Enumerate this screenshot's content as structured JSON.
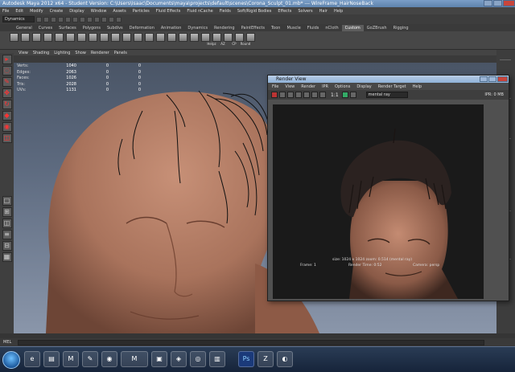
{
  "window": {
    "title": "Autodesk Maya 2012 x64 - Student Version: C:\\Users\\Isaac\\Documents\\maya\\projects\\default\\scenes\\Corona_Sculpt_01.mb* --- WireFrame_HairNoseBack"
  },
  "menubar": [
    "File",
    "Edit",
    "Modify",
    "Create",
    "Display",
    "Window",
    "Assets",
    "Particles",
    "Fluid Effects",
    "Fluid nCache",
    "Fields",
    "Soft/Rigid Bodies",
    "Effects",
    "Solvers",
    "Hair",
    "Help"
  ],
  "statusline": {
    "mode": "Dynamics"
  },
  "shelf_tabs": [
    "General",
    "Curves",
    "Surfaces",
    "Polygons",
    "Subdivs",
    "Deformation",
    "Animation",
    "Dynamics",
    "Rendering",
    "PaintEffects",
    "Toon",
    "Muscle",
    "Fluids",
    "nCloth",
    "Custom",
    "GoZBrush",
    "Rigging"
  ],
  "shelf_active": "Custom",
  "shelf_labels": [
    "Helpz",
    "AZ",
    "CP",
    "Round"
  ],
  "panel_menu": [
    "View",
    "Shading",
    "Lighting",
    "Show",
    "Renderer",
    "Panels"
  ],
  "hud": [
    {
      "label": "Verts:",
      "v1": "1040",
      "v2": "0",
      "v3": "0"
    },
    {
      "label": "Edges:",
      "v1": "2063",
      "v2": "0",
      "v3": "0"
    },
    {
      "label": "Faces:",
      "v1": "1026",
      "v2": "0",
      "v3": "0"
    },
    {
      "label": "Tris:",
      "v1": "2028",
      "v2": "0",
      "v3": "0"
    },
    {
      "label": "UVs:",
      "v1": "1131",
      "v2": "0",
      "v3": "0"
    }
  ],
  "render_view": {
    "title": "Render View",
    "menu": [
      "File",
      "View",
      "Render",
      "IPR",
      "Options",
      "Display",
      "Render Target",
      "Help"
    ],
    "ratio": "1:1",
    "renderer": "mental ray",
    "ipr_status": "IPR: 0 MB",
    "info_line1": "size: 1024 x 1024  zoom: 0.514    (mental ray)",
    "info_frame": "Frame: 1",
    "info_time": "Render Time: 0:52",
    "info_camera": "Camera: persp"
  },
  "mel": {
    "label": "MEL"
  },
  "taskbar": [
    "ie",
    "explorer",
    "maya",
    "paint",
    "chrome",
    "photoshop",
    "zbrush",
    "folder",
    "media"
  ],
  "colors": {
    "accent": "#5e83ad",
    "skin": "#b07a62",
    "hair": "#2b2220"
  }
}
